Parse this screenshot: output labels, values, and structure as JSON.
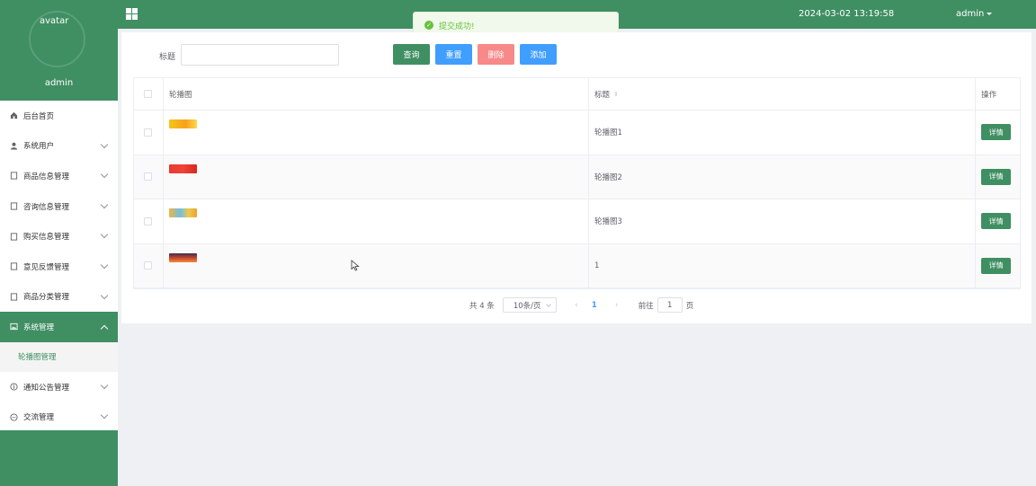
{
  "sidebar": {
    "avatar_alt": "avatar",
    "username": "admin",
    "items": [
      {
        "label": "后台首页",
        "icon": "home-icon",
        "has_arrow": false
      },
      {
        "label": "系统用户",
        "icon": "user-icon",
        "has_arrow": true
      },
      {
        "label": "商品信息管理",
        "icon": "document-icon",
        "has_arrow": true
      },
      {
        "label": "咨询信息管理",
        "icon": "document-icon",
        "has_arrow": true
      },
      {
        "label": "购买信息管理",
        "icon": "document-icon",
        "has_arrow": true
      },
      {
        "label": "意见反馈管理",
        "icon": "document-icon",
        "has_arrow": true
      },
      {
        "label": "商品分类管理",
        "icon": "document-icon",
        "has_arrow": true
      },
      {
        "label": "系统管理",
        "icon": "picture-icon",
        "has_arrow": true,
        "active": true
      },
      {
        "label": "通知公告管理",
        "icon": "info-icon",
        "has_arrow": true
      },
      {
        "label": "交流管理",
        "icon": "chat-icon",
        "has_arrow": true
      }
    ],
    "submenu": {
      "label": "轮播图管理"
    }
  },
  "topbar": {
    "title": "",
    "datetime": "2024-03-02 13:19:58",
    "user": "admin"
  },
  "toast": {
    "message": "提交成功!",
    "type": "success"
  },
  "search": {
    "label": "标题",
    "value": "",
    "buttons": {
      "query": "查询",
      "reset": "重置",
      "delete": "删除",
      "add": "添加"
    }
  },
  "table": {
    "headers": {
      "image": "轮播图",
      "title": "标题",
      "actions": "操作"
    },
    "rows": [
      {
        "title": "轮播图1",
        "thumb": "yellow"
      },
      {
        "title": "轮播图2",
        "thumb": "red"
      },
      {
        "title": "轮播图3",
        "thumb": "multicolor"
      },
      {
        "title": "1",
        "thumb": "sunset"
      }
    ],
    "detail_label": "详情"
  },
  "pagination": {
    "total": "共 4 条",
    "page_size": "10条/页",
    "current_page": "1",
    "goto_label": "前往",
    "goto_value": "1",
    "goto_suffix": "页"
  },
  "colors": {
    "primary": "#3f8f63",
    "blue": "#409eff",
    "danger": "#f78989",
    "success": "#67c23a"
  }
}
